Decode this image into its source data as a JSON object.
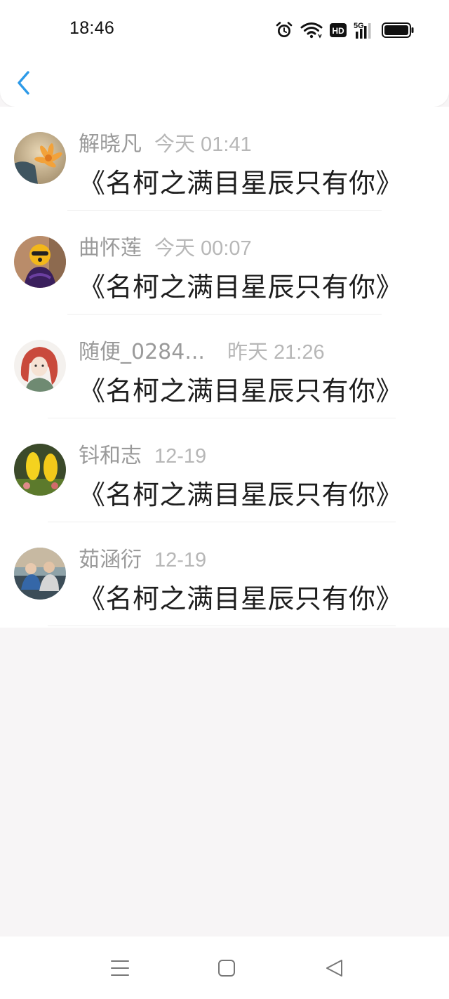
{
  "status_bar": {
    "time": "18:46",
    "icons": [
      "alarm-icon",
      "wifi-icon",
      "hd-icon",
      "signal-5g-icon",
      "battery-icon"
    ],
    "hd_label": "HD",
    "network_label": "5G"
  },
  "nav": {
    "back_icon": "chevron-left-icon",
    "accent": "#2d9ae8"
  },
  "messages": [
    {
      "name": "解晓凡",
      "time": "今天 01:41",
      "text": "《名柯之满目星辰只有你》"
    },
    {
      "name": "曲怀莲",
      "time": "今天 00:07",
      "text": "《名柯之满目星辰只有你》"
    },
    {
      "name": "随便_0284...",
      "time": "昨天 21:26",
      "text": "《名柯之满目星辰只有你》"
    },
    {
      "name": "钭和志",
      "time": "12-19",
      "text": "《名柯之满目星辰只有你》"
    },
    {
      "name": "茹涵衍",
      "time": "12-19",
      "text": "《名柯之满目星辰只有你》"
    }
  ],
  "system_nav": {
    "icons": [
      "menu-icon",
      "home-icon",
      "back-triangle-icon"
    ]
  }
}
